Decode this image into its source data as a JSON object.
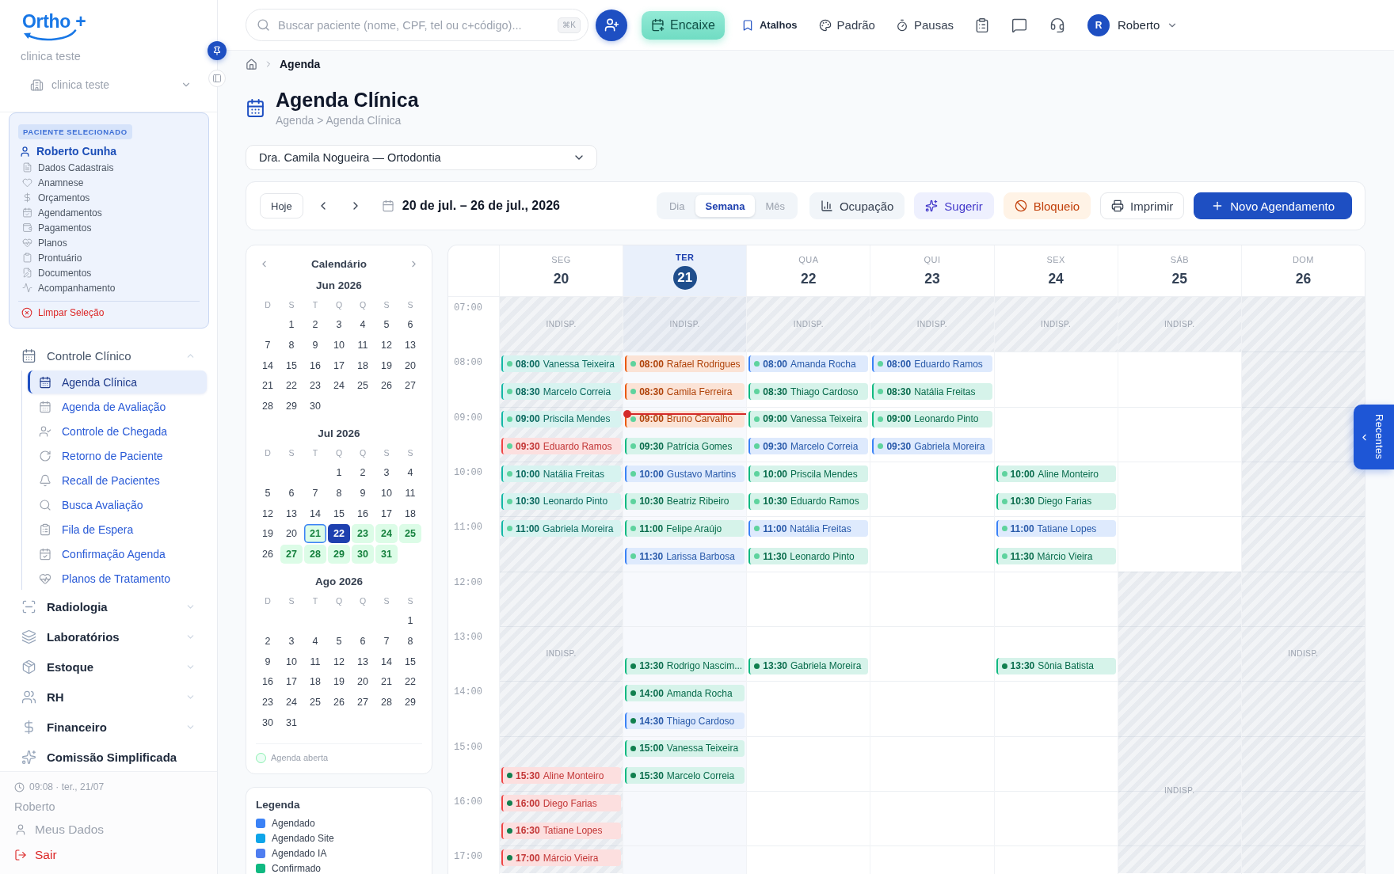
{
  "sidebar": {
    "brand": "Ortho +",
    "clinic_name": "clinica teste",
    "clinic_select": {
      "value": "clinica teste"
    },
    "patient": {
      "badge": "PACIENTE SELECIONADO",
      "name": "Roberto Cunha",
      "links": [
        "Dados Cadastrais",
        "Anamnese",
        "Orçamentos",
        "Agendamentos",
        "Pagamentos",
        "Planos",
        "Prontuário",
        "Documentos",
        "Acompanhamento"
      ],
      "clear": "Limpar Seleção"
    },
    "nav": [
      {
        "label": "Controle Clínico",
        "kind": "group",
        "expanded": true,
        "children": [
          {
            "label": "Agenda Clínica",
            "selected": true
          },
          {
            "label": "Agenda de Avaliação",
            "selected": false
          },
          {
            "label": "Controle de Chegada",
            "selected": false
          },
          {
            "label": "Retorno de Paciente",
            "selected": false
          },
          {
            "label": "Recall de Pacientes",
            "selected": false
          },
          {
            "label": "Busca Avaliação",
            "selected": false
          },
          {
            "label": "Fila de Espera",
            "selected": false
          },
          {
            "label": "Confirmação Agenda",
            "selected": false
          },
          {
            "label": "Planos de Tratamento",
            "selected": false
          }
        ]
      },
      {
        "label": "Radiologia",
        "kind": "group",
        "expanded": false
      },
      {
        "label": "Laboratórios",
        "kind": "group",
        "expanded": false
      },
      {
        "label": "Estoque",
        "kind": "group",
        "expanded": false
      },
      {
        "label": "RH",
        "kind": "group",
        "expanded": false
      },
      {
        "label": "Financeiro",
        "kind": "group",
        "expanded": false
      },
      {
        "label": "Comissão Simplificada",
        "kind": "link"
      }
    ],
    "footer": {
      "clock": "09:08 · ter., 21/07",
      "user": "Roberto",
      "links": [
        {
          "label": "Meus Dados",
          "kind": "profile"
        },
        {
          "label": "Sair",
          "kind": "logout"
        }
      ]
    }
  },
  "topbar": {
    "search": {
      "placeholder": "Buscar paciente (nome, CPF, tel ou c+código)...",
      "shortcut": "⌘K"
    },
    "fit_in": "Encaixe",
    "links": [
      {
        "label": "Atalhos",
        "kind": "shortcuts"
      },
      {
        "label": "Padrão",
        "kind": "theme"
      },
      {
        "label": "Pausas",
        "kind": "breaks"
      }
    ],
    "user": {
      "initial": "R",
      "name": "Roberto"
    }
  },
  "breadcrumb": [
    "Agenda"
  ],
  "header": {
    "title": "Agenda Clínica",
    "subtitle": "Agenda > Agenda Clínica"
  },
  "doctor_select": {
    "value": "Dra. Camila Nogueira — Ortodontia"
  },
  "toolbar": {
    "today_button": "Hoje",
    "range": "20 de jul. – 26 de jul., 2026",
    "views": [
      {
        "label": "Dia",
        "selected": false
      },
      {
        "label": "Semana",
        "selected": true
      },
      {
        "label": "Mês",
        "selected": false
      }
    ],
    "actions": [
      {
        "label": "Ocupação",
        "kind": "occupancy"
      },
      {
        "label": "Sugerir",
        "kind": "suggest"
      },
      {
        "label": "Bloqueio",
        "kind": "block"
      },
      {
        "label": "Imprimir",
        "kind": "print"
      },
      {
        "label": "Novo Agendamento",
        "kind": "new"
      }
    ]
  },
  "mini_calendar": {
    "title": "Calendário",
    "months": [
      {
        "label": "Jun 2026",
        "weekdays": [
          "D",
          "S",
          "T",
          "Q",
          "Q",
          "S",
          "S"
        ],
        "weeks": [
          [
            {
              "day": "1",
              "open": false,
              "today": false,
              "selected": false
            },
            {
              "day": "2",
              "open": false,
              "today": false,
              "selected": false
            },
            {
              "day": "3",
              "open": false,
              "today": false,
              "selected": false
            },
            {
              "day": "4",
              "open": false,
              "today": false,
              "selected": false
            },
            {
              "day": "5",
              "open": false,
              "today": false,
              "selected": false
            },
            {
              "day": "6",
              "open": false,
              "today": false,
              "selected": false
            }
          ],
          [
            {
              "day": "7",
              "open": false,
              "today": false,
              "selected": false
            },
            {
              "day": "8",
              "open": false,
              "today": false,
              "selected": false
            },
            {
              "day": "9",
              "open": false,
              "today": false,
              "selected": false
            },
            {
              "day": "10",
              "open": false,
              "today": false,
              "selected": false
            },
            {
              "day": "11",
              "open": false,
              "today": false,
              "selected": false
            },
            {
              "day": "12",
              "open": false,
              "today": false,
              "selected": false
            },
            {
              "day": "13",
              "open": false,
              "today": false,
              "selected": false
            }
          ],
          [
            {
              "day": "14",
              "open": false,
              "today": false,
              "selected": false
            },
            {
              "day": "15",
              "open": false,
              "today": false,
              "selected": false
            },
            {
              "day": "16",
              "open": false,
              "today": false,
              "selected": false
            },
            {
              "day": "17",
              "open": false,
              "today": false,
              "selected": false
            },
            {
              "day": "18",
              "open": false,
              "today": false,
              "selected": false
            },
            {
              "day": "19",
              "open": false,
              "today": false,
              "selected": false
            },
            {
              "day": "20",
              "open": false,
              "today": false,
              "selected": false
            }
          ],
          [
            {
              "day": "21",
              "open": false,
              "today": false,
              "selected": false
            },
            {
              "day": "22",
              "open": false,
              "today": false,
              "selected": false
            },
            {
              "day": "23",
              "open": false,
              "today": false,
              "selected": false
            },
            {
              "day": "24",
              "open": false,
              "today": false,
              "selected": false
            },
            {
              "day": "25",
              "open": false,
              "today": false,
              "selected": false
            },
            {
              "day": "26",
              "open": false,
              "today": false,
              "selected": false
            },
            {
              "day": "27",
              "open": false,
              "today": false,
              "selected": false
            }
          ],
          [
            {
              "day": "28",
              "open": false,
              "today": false,
              "selected": false
            },
            {
              "day": "29",
              "open": false,
              "today": false,
              "selected": false
            },
            {
              "day": "30",
              "open": false,
              "today": false,
              "selected": false
            }
          ]
        ]
      },
      {
        "label": "Jul 2026",
        "weekdays": [
          "D",
          "S",
          "T",
          "Q",
          "Q",
          "S",
          "S"
        ],
        "weeks": [
          [
            {
              "day": "1",
              "open": false,
              "today": false,
              "selected": false
            },
            {
              "day": "2",
              "open": false,
              "today": false,
              "selected": false
            },
            {
              "day": "3",
              "open": false,
              "today": false,
              "selected": false
            },
            {
              "day": "4",
              "open": false,
              "today": false,
              "selected": false
            }
          ],
          [
            {
              "day": "5",
              "open": false,
              "today": false,
              "selected": false
            },
            {
              "day": "6",
              "open": false,
              "today": false,
              "selected": false
            },
            {
              "day": "7",
              "open": false,
              "today": false,
              "selected": false
            },
            {
              "day": "8",
              "open": false,
              "today": false,
              "selected": false
            },
            {
              "day": "9",
              "open": false,
              "today": false,
              "selected": false
            },
            {
              "day": "10",
              "open": false,
              "today": false,
              "selected": false
            },
            {
              "day": "11",
              "open": false,
              "today": false,
              "selected": false
            }
          ],
          [
            {
              "day": "12",
              "open": false,
              "today": false,
              "selected": false
            },
            {
              "day": "13",
              "open": false,
              "today": false,
              "selected": false
            },
            {
              "day": "14",
              "open": false,
              "today": false,
              "selected": false
            },
            {
              "day": "15",
              "open": false,
              "today": false,
              "selected": false
            },
            {
              "day": "16",
              "open": false,
              "today": false,
              "selected": false
            },
            {
              "day": "17",
              "open": false,
              "today": false,
              "selected": false
            },
            {
              "day": "18",
              "open": false,
              "today": false,
              "selected": false
            }
          ],
          [
            {
              "day": "19",
              "open": false,
              "today": false,
              "selected": false
            },
            {
              "day": "20",
              "open": false,
              "today": false,
              "selected": false
            },
            {
              "day": "21",
              "open": true,
              "today": true,
              "selected": false
            },
            {
              "day": "22",
              "open": false,
              "today": false,
              "selected": true
            },
            {
              "day": "23",
              "open": true,
              "today": false,
              "selected": false
            },
            {
              "day": "24",
              "open": true,
              "today": false,
              "selected": false
            },
            {
              "day": "25",
              "open": true,
              "today": false,
              "selected": false
            }
          ],
          [
            {
              "day": "26",
              "open": false,
              "today": false,
              "selected": false
            },
            {
              "day": "27",
              "open": true,
              "today": false,
              "selected": false
            },
            {
              "day": "28",
              "open": true,
              "today": false,
              "selected": false
            },
            {
              "day": "29",
              "open": true,
              "today": false,
              "selected": false
            },
            {
              "day": "30",
              "open": true,
              "today": false,
              "selected": false
            },
            {
              "day": "31",
              "open": true,
              "today": false,
              "selected": false
            }
          ]
        ]
      },
      {
        "label": "Ago 2026",
        "weekdays": [
          "D",
          "S",
          "T",
          "Q",
          "Q",
          "S",
          "S"
        ],
        "weeks": [
          [
            {
              "day": "1",
              "open": false,
              "today": false,
              "selected": false
            }
          ],
          [
            {
              "day": "2",
              "open": false,
              "today": false,
              "selected": false
            },
            {
              "day": "3",
              "open": false,
              "today": false,
              "selected": false
            },
            {
              "day": "4",
              "open": false,
              "today": false,
              "selected": false
            },
            {
              "day": "5",
              "open": false,
              "today": false,
              "selected": false
            },
            {
              "day": "6",
              "open": false,
              "today": false,
              "selected": false
            },
            {
              "day": "7",
              "open": false,
              "today": false,
              "selected": false
            },
            {
              "day": "8",
              "open": false,
              "today": false,
              "selected": false
            }
          ],
          [
            {
              "day": "9",
              "open": false,
              "today": false,
              "selected": false
            },
            {
              "day": "10",
              "open": false,
              "today": false,
              "selected": false
            },
            {
              "day": "11",
              "open": false,
              "today": false,
              "selected": false
            },
            {
              "day": "12",
              "open": false,
              "today": false,
              "selected": false
            },
            {
              "day": "13",
              "open": false,
              "today": false,
              "selected": false
            },
            {
              "day": "14",
              "open": false,
              "today": false,
              "selected": false
            },
            {
              "day": "15",
              "open": false,
              "today": false,
              "selected": false
            }
          ],
          [
            {
              "day": "16",
              "open": false,
              "today": false,
              "selected": false
            },
            {
              "day": "17",
              "open": false,
              "today": false,
              "selected": false
            },
            {
              "day": "18",
              "open": false,
              "today": false,
              "selected": false
            },
            {
              "day": "19",
              "open": false,
              "today": false,
              "selected": false
            },
            {
              "day": "20",
              "open": false,
              "today": false,
              "selected": false
            },
            {
              "day": "21",
              "open": false,
              "today": false,
              "selected": false
            },
            {
              "day": "22",
              "open": false,
              "today": false,
              "selected": false
            }
          ],
          [
            {
              "day": "23",
              "open": false,
              "today": false,
              "selected": false
            },
            {
              "day": "24",
              "open": false,
              "today": false,
              "selected": false
            },
            {
              "day": "25",
              "open": false,
              "today": false,
              "selected": false
            },
            {
              "day": "26",
              "open": false,
              "today": false,
              "selected": false
            },
            {
              "day": "27",
              "open": false,
              "today": false,
              "selected": false
            },
            {
              "day": "28",
              "open": false,
              "today": false,
              "selected": false
            },
            {
              "day": "29",
              "open": false,
              "today": false,
              "selected": false
            }
          ],
          [
            {
              "day": "30",
              "open": false,
              "today": false,
              "selected": false
            },
            {
              "day": "31",
              "open": false,
              "today": false,
              "selected": false
            }
          ]
        ]
      }
    ],
    "footer": "Agenda aberta"
  },
  "legend": {
    "title": "Legenda",
    "items": [
      {
        "label": "Agendado",
        "color": "#3b82f6"
      },
      {
        "label": "Agendado Site",
        "color": "#0ea5e9"
      },
      {
        "label": "Agendado IA",
        "color": "#4f7ef0"
      },
      {
        "label": "Confirmado",
        "color": "#10b981"
      }
    ]
  },
  "schedule": {
    "hours": [
      "07:00",
      "08:00",
      "09:00",
      "10:00",
      "11:00",
      "12:00",
      "13:00",
      "14:00",
      "15:00",
      "16:00",
      "17:00"
    ],
    "days": [
      {
        "weekday": "SEG",
        "date": "20",
        "today": false,
        "blocked": [
          {
            "kind": "early",
            "label": "INDISP."
          },
          {
            "kind": "workday",
            "label": "INDISP."
          }
        ],
        "appointments": [
          {
            "time": "08:00",
            "name": "Vanessa Teixeira",
            "color": "#14b8a6",
            "dot": {
              "color": "#5ed39e"
            }
          },
          {
            "time": "08:30",
            "name": "Marcelo Correia",
            "color": "#14b8a6",
            "dot": {
              "color": "#5ed39e"
            }
          },
          {
            "time": "09:00",
            "name": "Priscila Mendes",
            "color": "#14b8a6",
            "dot": {
              "color": "#5ed39e"
            }
          },
          {
            "time": "09:30",
            "name": "Eduardo Ramos",
            "color": "#ef4444",
            "dot": {
              "color": "#5ed39e"
            }
          },
          {
            "time": "10:00",
            "name": "Natália Freitas",
            "color": "#14b8a6",
            "dot": {
              "color": "#5ed39e"
            }
          },
          {
            "time": "10:30",
            "name": "Leonardo Pinto",
            "color": "#14b8a6",
            "dot": {
              "color": "#5ed39e"
            }
          },
          {
            "time": "11:00",
            "name": "Gabriela Moreira",
            "color": "#14b8a6",
            "dot": {
              "color": "#5ed39e"
            }
          },
          {
            "time": "15:30",
            "name": "Aline Monteiro",
            "color": "#ef4444",
            "dot": {
              "color": "#11804f"
            }
          },
          {
            "time": "16:00",
            "name": "Diego Farias",
            "color": "#ef4444",
            "dot": {
              "color": "#11804f"
            }
          },
          {
            "time": "16:30",
            "name": "Tatiane Lopes",
            "color": "#ef4444",
            "dot": {
              "color": "#11804f"
            }
          },
          {
            "time": "17:00",
            "name": "Márcio Vieira",
            "color": "#ef4444",
            "dot": {
              "color": "#11804f"
            }
          }
        ]
      },
      {
        "weekday": "TER",
        "date": "21",
        "today": true,
        "blocked": [
          {
            "kind": "early",
            "label": "INDISP."
          }
        ],
        "appointments": [
          {
            "time": "08:00",
            "name": "Rafael Rodrigues",
            "color": "#ea580c",
            "dot": {
              "color": "#5ed39e"
            }
          },
          {
            "time": "08:30",
            "name": "Camila Ferreira",
            "color": "#ea580c",
            "dot": {
              "color": "#5ed39e"
            }
          },
          {
            "time": "09:00",
            "name": "Bruno Carvalho",
            "color": "#ea580c",
            "dot": {
              "color": "#5ed39e"
            }
          },
          {
            "time": "09:30",
            "name": "Patrícia Gomes",
            "color": "#10b981",
            "dot": {
              "color": "#5ed39e"
            }
          },
          {
            "time": "10:00",
            "name": "Gustavo Martins",
            "color": "#3b82f6",
            "dot": {
              "color": "#5ed39e"
            }
          },
          {
            "time": "10:30",
            "name": "Beatriz Ribeiro",
            "color": "#10b981",
            "dot": {
              "color": "#5ed39e"
            }
          },
          {
            "time": "11:00",
            "name": "Felipe Araújo",
            "color": "#10b981",
            "dot": {
              "color": "#5ed39e"
            }
          },
          {
            "time": "11:30",
            "name": "Larissa Barbosa",
            "color": "#3b82f6",
            "dot": {
              "color": "#5ed39e"
            }
          },
          {
            "time": "13:30",
            "name": "Rodrigo Nascim...",
            "color": "#10b981",
            "dot": {
              "color": "#11804f"
            }
          },
          {
            "time": "14:00",
            "name": "Amanda Rocha",
            "color": "#10b981",
            "dot": {
              "color": "#11804f"
            }
          },
          {
            "time": "14:30",
            "name": "Thiago Cardoso",
            "color": "#3b82f6",
            "dot": {
              "color": "#11804f"
            }
          },
          {
            "time": "15:00",
            "name": "Vanessa Teixeira",
            "color": "#10b981",
            "dot": {
              "color": "#11804f"
            }
          },
          {
            "time": "15:30",
            "name": "Marcelo Correia",
            "color": "#10b981",
            "dot": {
              "color": "#11804f"
            }
          }
        ]
      },
      {
        "weekday": "QUA",
        "date": "22",
        "today": false,
        "blocked": [
          {
            "kind": "early",
            "label": "INDISP."
          }
        ],
        "appointments": [
          {
            "time": "08:00",
            "name": "Amanda Rocha",
            "color": "#3b82f6",
            "dot": {
              "color": "#5ed39e"
            }
          },
          {
            "time": "08:30",
            "name": "Thiago Cardoso",
            "color": "#10b981",
            "dot": {
              "color": "#5ed39e"
            }
          },
          {
            "time": "09:00",
            "name": "Vanessa Teixeira",
            "color": "#10b981",
            "dot": {
              "color": "#5ed39e"
            }
          },
          {
            "time": "09:30",
            "name": "Marcelo Correia",
            "color": "#3b82f6",
            "dot": {
              "color": "#5ed39e"
            }
          },
          {
            "time": "10:00",
            "name": "Priscila Mendes",
            "color": "#10b981",
            "dot": {
              "color": "#5ed39e"
            }
          },
          {
            "time": "10:30",
            "name": "Eduardo Ramos",
            "color": "#10b981",
            "dot": {
              "color": "#5ed39e"
            }
          },
          {
            "time": "11:00",
            "name": "Natália Freitas",
            "color": "#3b82f6",
            "dot": {
              "color": "#5ed39e"
            }
          },
          {
            "time": "11:30",
            "name": "Leonardo Pinto",
            "color": "#10b981",
            "dot": {
              "color": "#5ed39e"
            }
          },
          {
            "time": "13:30",
            "name": "Gabriela Moreira",
            "color": "#10b981",
            "dot": {
              "color": "#11804f"
            }
          }
        ]
      },
      {
        "weekday": "QUI",
        "date": "23",
        "today": false,
        "blocked": [
          {
            "kind": "early",
            "label": "INDISP."
          }
        ],
        "appointments": [
          {
            "time": "08:00",
            "name": "Eduardo Ramos",
            "color": "#3b82f6",
            "dot": {
              "color": "#5ed39e"
            }
          },
          {
            "time": "08:30",
            "name": "Natália Freitas",
            "color": "#10b981",
            "dot": {
              "color": "#5ed39e"
            }
          },
          {
            "time": "09:00",
            "name": "Leonardo Pinto",
            "color": "#10b981",
            "dot": {
              "color": "#5ed39e"
            }
          },
          {
            "time": "09:30",
            "name": "Gabriela Moreira",
            "color": "#3b82f6",
            "dot": {
              "color": "#5ed39e"
            }
          }
        ]
      },
      {
        "weekday": "SEX",
        "date": "24",
        "today": false,
        "blocked": [
          {
            "kind": "early",
            "label": "INDISP."
          }
        ],
        "appointments": [
          {
            "time": "10:00",
            "name": "Aline Monteiro",
            "color": "#10b981",
            "dot": {
              "color": "#5ed39e"
            }
          },
          {
            "time": "10:30",
            "name": "Diego Farias",
            "color": "#10b981",
            "dot": {
              "color": "#5ed39e"
            }
          },
          {
            "time": "11:00",
            "name": "Tatiane Lopes",
            "color": "#3b82f6",
            "dot": {
              "color": "#5ed39e"
            }
          },
          {
            "time": "11:30",
            "name": "Márcio Vieira",
            "color": "#10b981",
            "dot": {
              "color": "#5ed39e"
            }
          },
          {
            "time": "13:30",
            "name": "Sônia Batista",
            "color": "#10b981",
            "dot": {
              "color": "#11804f"
            }
          }
        ]
      },
      {
        "weekday": "SÁB",
        "date": "25",
        "today": false,
        "blocked": [
          {
            "kind": "early",
            "label": "INDISP."
          },
          {
            "kind": "afternoon",
            "label": "INDISP."
          }
        ]
      },
      {
        "weekday": "DOM",
        "date": "26",
        "today": false,
        "blocked": [
          {
            "kind": "allday",
            "label": "INDISP."
          }
        ]
      }
    ]
  },
  "recent_tab": {
    "label": "Recentes"
  }
}
